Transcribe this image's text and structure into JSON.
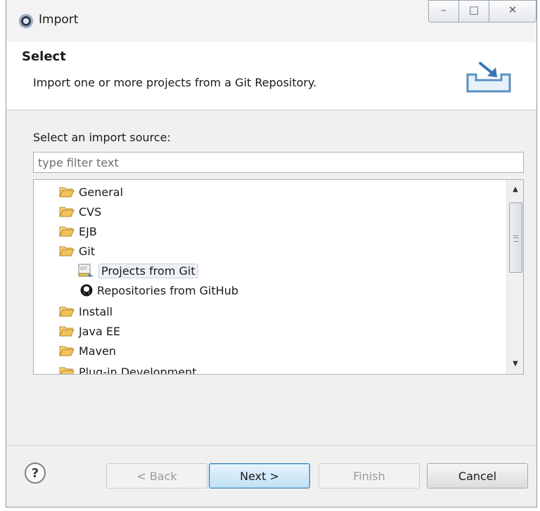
{
  "window": {
    "title": "Import"
  },
  "window_controls": {
    "minimize": "–",
    "maximize": "□",
    "close": "✕"
  },
  "banner": {
    "title": "Select",
    "description": "Import one or more projects from a Git Repository."
  },
  "source": {
    "label": "Select an import source:",
    "filter_placeholder": "type filter text",
    "filter_value": ""
  },
  "tree": {
    "items": [
      {
        "label": "General"
      },
      {
        "label": "CVS"
      },
      {
        "label": "EJB"
      },
      {
        "label": "Git"
      },
      {
        "label": "Projects from Git",
        "selected": true
      },
      {
        "label": "Repositories from GitHub"
      },
      {
        "label": "Install"
      },
      {
        "label": "Java EE"
      },
      {
        "label": "Maven"
      },
      {
        "label": "Plug-in Development"
      }
    ]
  },
  "footer": {
    "help": "?",
    "back_label": "< Back",
    "next_label": "Next >",
    "finish_label": "Finish",
    "cancel_label": "Cancel"
  },
  "colors": {
    "folder": "#e9b84a",
    "accent": "#3c7fb1"
  }
}
